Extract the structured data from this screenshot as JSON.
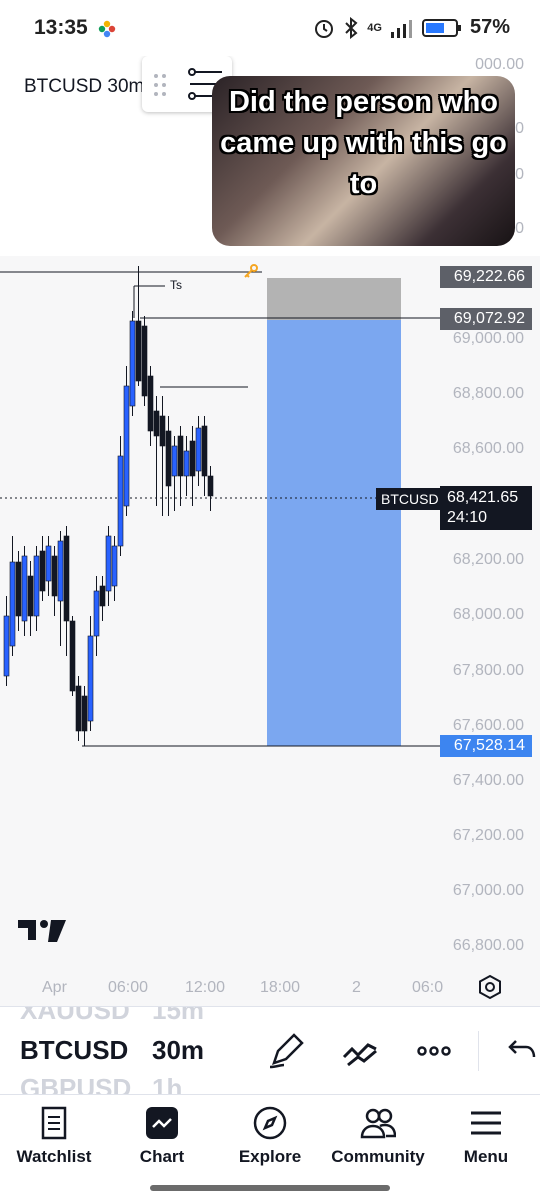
{
  "status_bar": {
    "time": "13:35",
    "network": "4G",
    "battery_percent": "57%"
  },
  "chart": {
    "symbol_interval": "BTCUSD 30m",
    "meme_text": "Did the person who came up with this go to",
    "price_scale": [
      "69,000.00",
      "68,800.00",
      "68,600.00",
      "68,200.00",
      "68,000.00",
      "67,800.00",
      "67,600.00",
      "67,400.00",
      "67,200.00",
      "67,000.00",
      "66,800.00"
    ],
    "top_clipped_labels": [
      "000.00",
      ".00",
      ".00",
      ".00"
    ],
    "stop_price": "69,222.66",
    "entry_price": "69,072.92",
    "target_price": "67,528.14",
    "current_price": "68,421.65",
    "countdown": "24:10",
    "symbol_tag": "BTCUSD",
    "ts_label": "Ts",
    "time_axis": [
      "Apr",
      "06:00",
      "12:00",
      "18:00",
      "2",
      "06:0"
    ],
    "colors": {
      "bull": "#2962ff",
      "bear": "#131722",
      "target_zone": "#7ba7f0",
      "stop_zone": "#b3b3b3",
      "target_tag": "#3d85f0",
      "gray_tag": "#5d6068"
    }
  },
  "selector": {
    "prev_symbol": "XAUUSD",
    "prev_interval": "15m",
    "symbol": "BTCUSD",
    "interval": "30m",
    "next_symbol": "GBPUSD",
    "next_interval": "1h",
    "tools": [
      "pencil-icon",
      "trend-tool-icon",
      "more-icon",
      "undo-icon"
    ]
  },
  "nav": {
    "items": [
      {
        "label": "Watchlist",
        "icon": "list-icon"
      },
      {
        "label": "Chart",
        "icon": "chart-icon"
      },
      {
        "label": "Explore",
        "icon": "compass-icon"
      },
      {
        "label": "Community",
        "icon": "people-icon"
      },
      {
        "label": "Menu",
        "icon": "hamburger-icon"
      }
    ]
  }
}
